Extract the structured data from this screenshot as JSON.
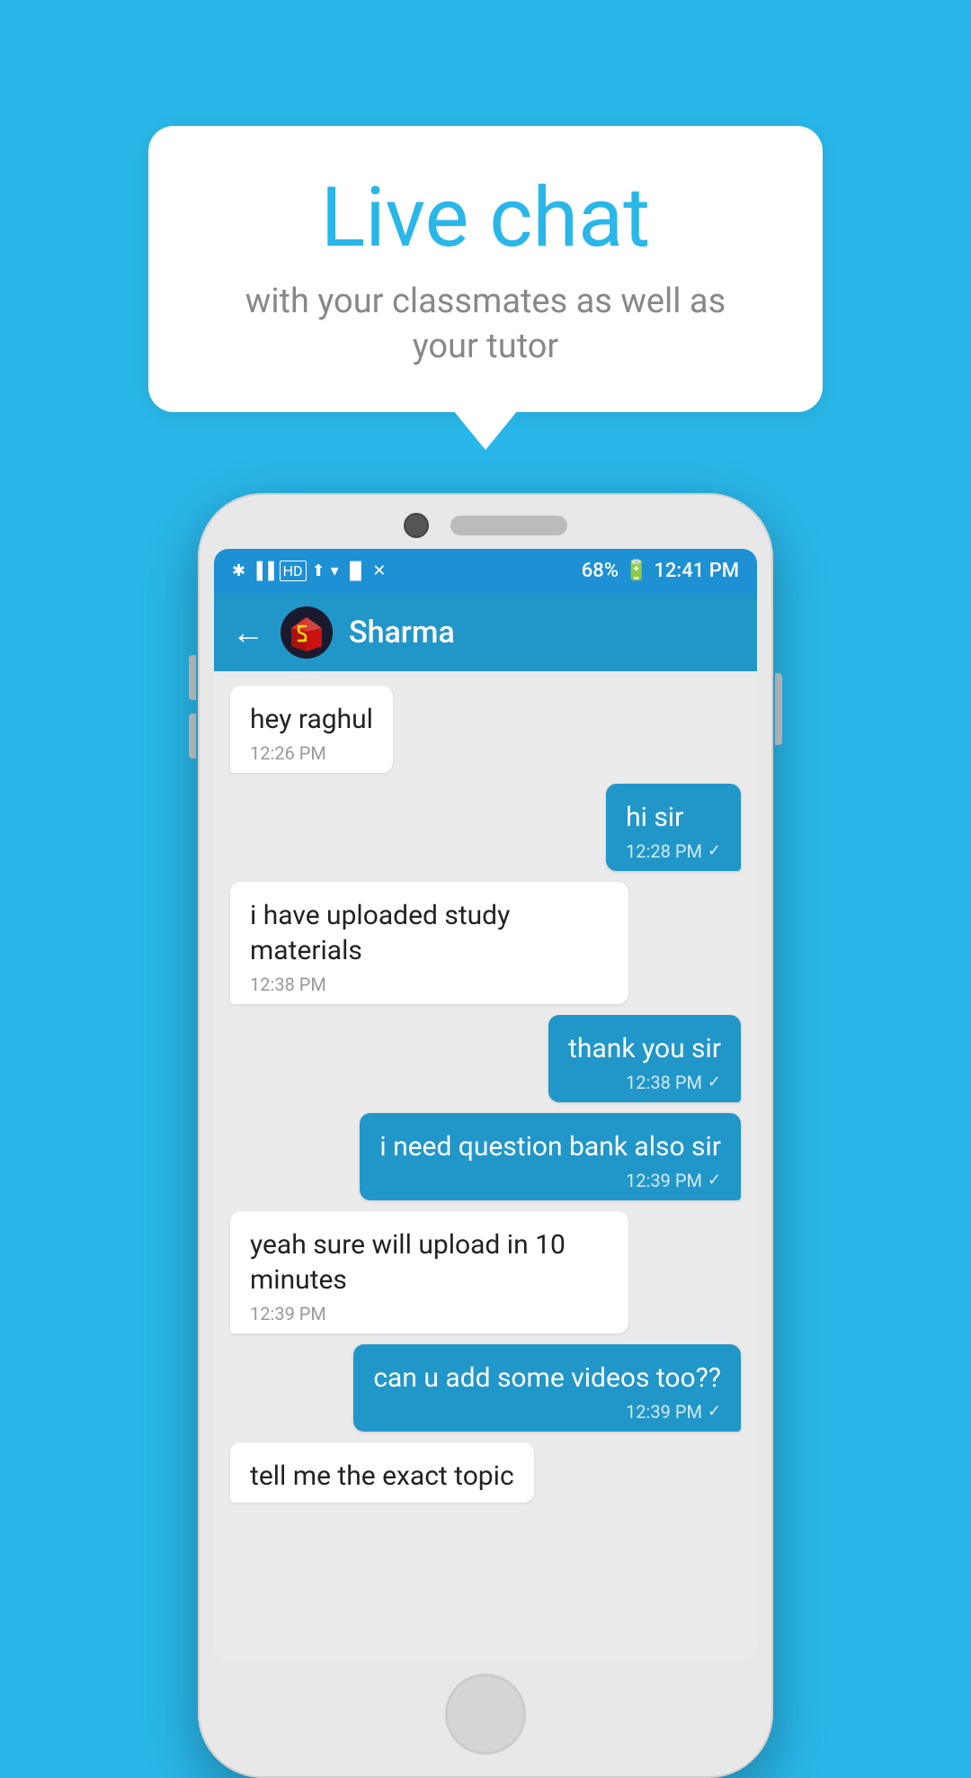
{
  "background_color": "#29b6e8",
  "bubble": {
    "title": "Live chat",
    "subtitle": "with your classmates as well as your tutor"
  },
  "status_bar": {
    "time": "12:41 PM",
    "battery": "68%",
    "icons": "bluetooth signal wifi"
  },
  "chat_header": {
    "back_label": "←",
    "contact_name": "Sharma"
  },
  "messages": [
    {
      "id": "msg1",
      "type": "received",
      "text": "hey raghul",
      "time": "12:26 PM"
    },
    {
      "id": "msg2",
      "type": "sent",
      "text": "hi sir",
      "time": "12:28 PM"
    },
    {
      "id": "msg3",
      "type": "received",
      "text": "i have uploaded study materials",
      "time": "12:38 PM"
    },
    {
      "id": "msg4",
      "type": "sent",
      "text": "thank you sir",
      "time": "12:38 PM"
    },
    {
      "id": "msg5",
      "type": "sent",
      "text": "i need question bank also sir",
      "time": "12:39 PM"
    },
    {
      "id": "msg6",
      "type": "received",
      "text": "yeah sure will upload in 10 minutes",
      "time": "12:39 PM"
    },
    {
      "id": "msg7",
      "type": "sent",
      "text": "can u add some videos too??",
      "time": "12:39 PM"
    },
    {
      "id": "msg8",
      "type": "received",
      "text": "tell me the exact topic",
      "time": ""
    }
  ]
}
